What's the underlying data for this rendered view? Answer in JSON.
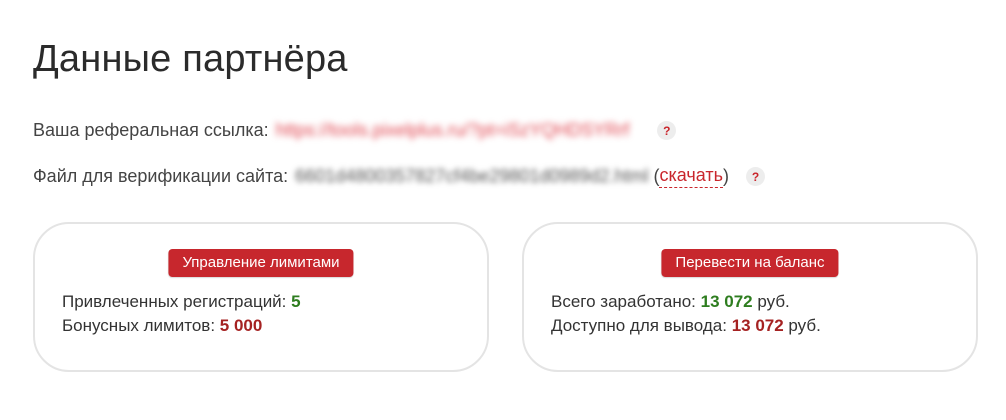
{
  "page": {
    "title": "Данные партнёра"
  },
  "referral": {
    "label": "Ваша реферальная ссылка:",
    "link": "https://tools.pixelplus.ru/?pt=iSzYQHDSYRrf",
    "help": "?"
  },
  "verification": {
    "label": "Файл для верификации сайта:",
    "filename": "6601d4800357827cf4be29801d0989d2.html",
    "open_paren": "(",
    "download_label": "скачать",
    "close_paren": ")",
    "help": "?"
  },
  "limits_card": {
    "button_label": "Управление лимитами",
    "registrations_label": "Привлеченных регистраций:",
    "registrations_value": "5",
    "bonus_label": "Бонусных лимитов:",
    "bonus_value": "5 000"
  },
  "balance_card": {
    "button_label": "Перевести на баланс",
    "earned_label": "Всего заработано:",
    "earned_value": "13 072",
    "earned_unit": "руб.",
    "available_label": "Доступно для вывода:",
    "available_value": "13 072",
    "available_unit": "руб."
  },
  "colors": {
    "accent_red": "#c7272d",
    "value_green": "#2e7d1f",
    "value_red": "#a52222",
    "link_red": "#e0454f"
  }
}
